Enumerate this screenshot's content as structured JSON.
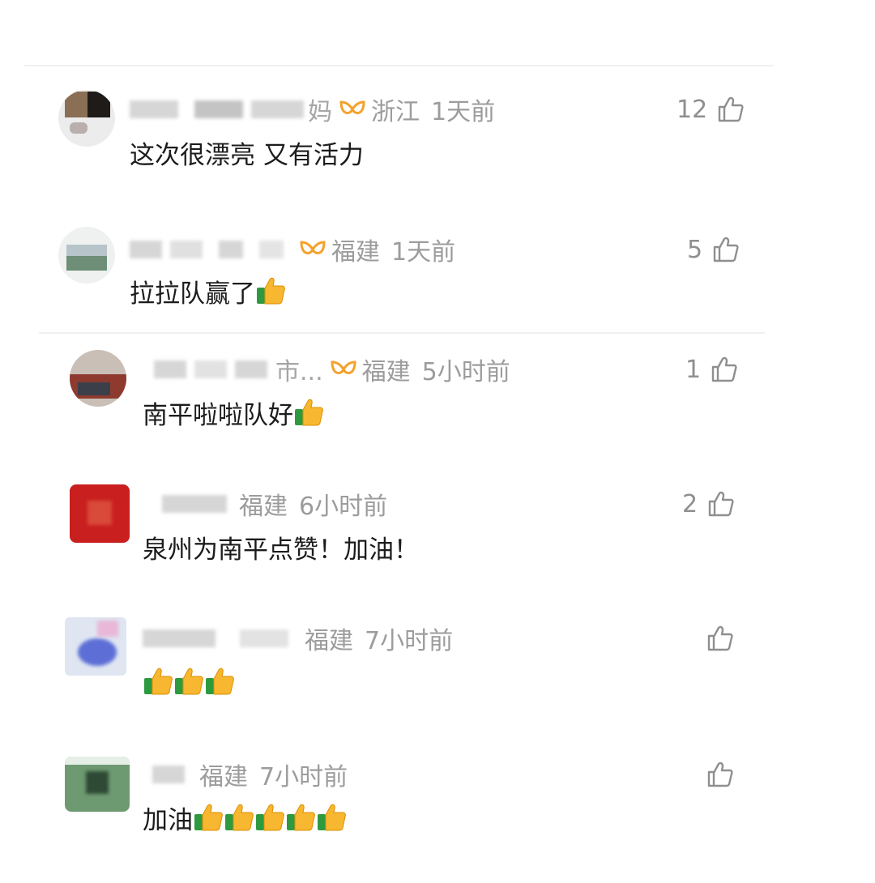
{
  "icons": {
    "like": "thumbs-up-outline-icon",
    "emoji": "thumbs-up-emoji",
    "badge": "gold-badge-icon"
  },
  "colors": {
    "meta": "#9c9c9c",
    "badge": "#f4a22d",
    "text": "#1c1c1c"
  },
  "comments": [
    {
      "name_tail": "妈",
      "location": "浙江",
      "time": "1天前",
      "text": "这次很漂亮 又有活力",
      "likes": "12",
      "emoji_count": 0
    },
    {
      "name_tail": "",
      "location": "福建",
      "time": "1天前",
      "text": "拉拉队赢了",
      "likes": "5",
      "emoji_count": 1
    },
    {
      "name_tail": "市...",
      "location": "福建",
      "time": "5小时前",
      "text": "南平啦啦队好",
      "likes": "1",
      "emoji_count": 1
    },
    {
      "name_tail": "",
      "location": "福建",
      "time": "6小时前",
      "text": "泉州为南平点赞！加油！",
      "likes": "2",
      "emoji_count": 0
    },
    {
      "name_tail": "",
      "location": "福建",
      "time": "7小时前",
      "text": "",
      "likes": "",
      "emoji_count": 3
    },
    {
      "name_tail": "",
      "location": "福建",
      "time": "7小时前",
      "text": "加油",
      "likes": "",
      "emoji_count": 5
    }
  ]
}
